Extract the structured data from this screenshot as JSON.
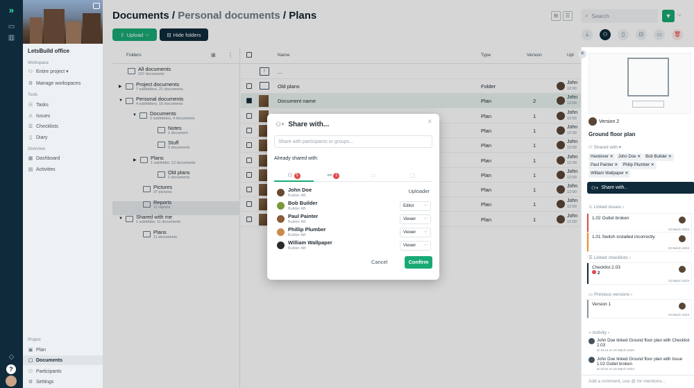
{
  "rail": {
    "logo": "»"
  },
  "sidebar": {
    "project_name": "LetsBuild office",
    "sections": {
      "workspace": "Workspace",
      "tools": "Tools",
      "overview": "Overview",
      "project": "Project"
    },
    "workspace_items": [
      {
        "label": "Entire project ▾",
        "icon": "people-icon"
      },
      {
        "label": "Manage workspaces",
        "icon": "gear-icon"
      }
    ],
    "tools_items": [
      {
        "label": "Tasks",
        "icon": "tasks-icon"
      },
      {
        "label": "Issues",
        "icon": "warning-icon"
      },
      {
        "label": "Checklists",
        "icon": "checklist-icon"
      },
      {
        "label": "Diary",
        "icon": "diary-icon"
      }
    ],
    "overview_items": [
      {
        "label": "Dashboard",
        "icon": "dashboard-icon"
      },
      {
        "label": "Activities",
        "icon": "activities-icon"
      }
    ],
    "project_items": [
      {
        "label": "Plan",
        "icon": "plan-icon"
      },
      {
        "label": "Documents",
        "icon": "documents-icon"
      },
      {
        "label": "Participants",
        "icon": "participants-icon"
      },
      {
        "label": "Settings",
        "icon": "gear-icon"
      }
    ]
  },
  "header": {
    "title_part1": "Documents / ",
    "title_part2": "Personal documents",
    "title_part3": " / Plans",
    "upload_label": "Upload",
    "hide_folders_label": "Hide folders",
    "search_placeholder": "Search"
  },
  "tree": {
    "header": "Folders",
    "nodes": [
      {
        "name": "All documents",
        "sub": "197 documents"
      },
      {
        "name": "Project documents",
        "sub": "7 subfolders, 21 documents"
      },
      {
        "name": "Personal documents",
        "sub": "4 subfolders, 15 documents"
      },
      {
        "name": "Documents",
        "sub": "2 subfolders, 4 documents"
      },
      {
        "name": "Notes",
        "sub": "1 document"
      },
      {
        "name": "Stuff",
        "sub": "3 documents"
      },
      {
        "name": "Plans",
        "sub": "1 subfolder, 12 documents"
      },
      {
        "name": "Old plans",
        "sub": "2 documents"
      },
      {
        "name": "Pictures",
        "sub": "37 pictures"
      },
      {
        "name": "Reports",
        "sub": "11 reports"
      },
      {
        "name": "Shared with me",
        "sub": "1 subfolder, 11 documents"
      },
      {
        "name": "Plans",
        "sub": "11 documents"
      }
    ]
  },
  "table": {
    "columns": {
      "name": "Name",
      "type": "Type",
      "version": "Version",
      "uploader": "Upl"
    },
    "parent_row": "...",
    "rows": [
      {
        "name": "Old plans",
        "type": "Folder",
        "version": "",
        "uploader": "John",
        "time": "12:00",
        "kind": "folder"
      },
      {
        "name": "Document name",
        "type": "Plan",
        "version": "2",
        "uploader": "John",
        "time": "12:00",
        "kind": "plan",
        "selected": true
      },
      {
        "name": "",
        "type": "Plan",
        "version": "1",
        "uploader": "John",
        "time": "12:00",
        "kind": "plan"
      },
      {
        "name": "",
        "type": "Plan",
        "version": "1",
        "uploader": "John",
        "time": "12:00",
        "kind": "plan"
      },
      {
        "name": "",
        "type": "Plan",
        "version": "1",
        "uploader": "John",
        "time": "12:00",
        "kind": "plan"
      },
      {
        "name": "",
        "type": "Plan",
        "version": "1",
        "uploader": "John",
        "time": "12:00",
        "kind": "plan"
      },
      {
        "name": "",
        "type": "Plan",
        "version": "1",
        "uploader": "John",
        "time": "12:00",
        "kind": "plan"
      },
      {
        "name": "",
        "type": "Plan",
        "version": "1",
        "uploader": "John",
        "time": "12:00",
        "kind": "plan"
      },
      {
        "name": "",
        "type": "Plan",
        "version": "1",
        "uploader": "John",
        "time": "12:00",
        "kind": "plan"
      },
      {
        "name": "",
        "type": "Plan",
        "version": "1",
        "uploader": "John",
        "time": "12:00",
        "kind": "plan"
      }
    ]
  },
  "panel": {
    "version": "Version 2",
    "title": "Ground floor plan",
    "shared_with": "Shared with ▾",
    "chips": [
      "Handover ✕",
      "John Doe ✕",
      "Bob Builder ✕",
      "Paul Painter ✕",
      "Philip Plumber ✕",
      "William Wallpaper ✕"
    ],
    "share_button": "Share with..",
    "linked_issues": "Linked issues ›",
    "issues": [
      {
        "title": "1.02 Outlet broken",
        "date": "23 March 2023",
        "color": "#e04a4a"
      },
      {
        "title": "1.01 Switch installed incorrectly",
        "date": "23 March 2023",
        "color": "#f08a24"
      }
    ],
    "linked_checklists": "Linked checklists ›",
    "checklist": {
      "title": "Checklist 2.03",
      "count": "2",
      "date": "23 March 2023",
      "color": "#0f2a3a"
    },
    "previous_versions": "Previous versions ›",
    "prev_version": {
      "title": "Version 1",
      "date": "23 March 2023"
    },
    "activity": "Activity ›",
    "activities": [
      {
        "text": "John Doe linked Ground floor plan with Checklist 2.03",
        "time": "at 10:14 on 24 March 2023"
      },
      {
        "text": "John Doe linked Ground floor plan with Issue 1.02 Outlet broken",
        "time": "at 10:01 on 24 March 2023"
      }
    ],
    "comment_placeholder": "Add a comment, use @ for mentions..."
  },
  "modal": {
    "title": "Share with...",
    "input_placeholder": "Share with participants or groups...",
    "already_shared": "Already shared with:",
    "tab_users_count": "5",
    "tab_groups_count": "1",
    "users": [
      {
        "name": "John Doe",
        "company": "Builder AB",
        "role": "Uploader",
        "editable": false,
        "avatar_color": "#6b4a32"
      },
      {
        "name": "Bob Builder",
        "company": "Builder AB",
        "role": "Editor",
        "editable": true,
        "avatar_color": "#7a9a3a"
      },
      {
        "name": "Paul Painter",
        "company": "Builder AB",
        "role": "Viewer",
        "editable": true,
        "avatar_color": "#8a5a3a"
      },
      {
        "name": "Phillip Plumber",
        "company": "Builder AB",
        "role": "Viewer",
        "editable": true,
        "avatar_color": "#c98a4a"
      },
      {
        "name": "William Wallpaper",
        "company": "Builder AB",
        "role": "Viewer",
        "editable": true,
        "avatar_color": "#2a2a2a"
      }
    ],
    "cancel_label": "Cancel",
    "confirm_label": "Confirm"
  },
  "colors": {
    "accent": "#19a974",
    "navy": "#0f2a3a",
    "danger": "#e04a4a"
  }
}
